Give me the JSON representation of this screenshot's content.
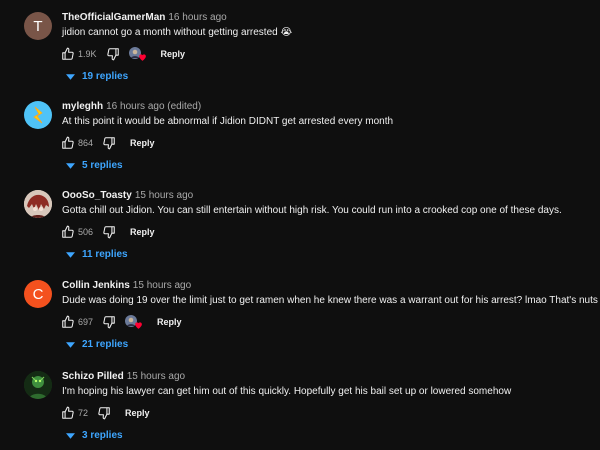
{
  "comments": [
    {
      "author": "TheOfficialGamerMan",
      "time": "16 hours ago",
      "text": "jidion cannot go a month without getting arrested 😭",
      "likes": "1.9K",
      "reply_label": "Reply",
      "replies_label": "19 replies",
      "avatar_letter": "T",
      "avatar_color": "#795548",
      "hearted": true
    },
    {
      "author": "myleghh",
      "time": "16 hours ago (edited)",
      "text": "At this point it would be abnormal if Jidion DIDNT get arrested every month",
      "likes": "864",
      "reply_label": "Reply",
      "replies_label": "5 replies",
      "avatar_icon": "yellow-lightning-icon",
      "avatar_color": "#4fc3f7",
      "hearted": false
    },
    {
      "author": "OooSo_Toasty",
      "time": "15 hours ago",
      "text": "Gotta chill out Jidion. You can still entertain without high risk. You could run into a crooked cop one of these days.",
      "likes": "506",
      "reply_label": "Reply",
      "replies_label": "11 replies",
      "avatar_icon": "anime-character-icon",
      "avatar_color": "#d8c7bb",
      "hearted": false
    },
    {
      "author": "Collin Jenkins",
      "time": "15 hours ago",
      "text": "Dude was doing 19 over the limit just to get ramen when he knew there was a warrant out for his arrest? lmao That's nuts",
      "likes": "697",
      "reply_label": "Reply",
      "replies_label": "21 replies",
      "avatar_letter": "C",
      "avatar_color": "#f4511e",
      "hearted": true
    },
    {
      "author": "Schizo Pilled",
      "time": "15 hours ago",
      "text": "I'm hoping his lawyer can get him out of this quickly. Hopefully get his bail set up or lowered somehow",
      "likes": "72",
      "reply_label": "Reply",
      "replies_label": "3 replies",
      "avatar_icon": "green-character-icon",
      "avatar_color": "#1b3d1b",
      "hearted": false
    }
  ],
  "colors": {
    "background": "#0f0f0f",
    "text": "#f1f1f1",
    "muted": "#aaaaaa",
    "link": "#3ea6ff",
    "heart": "#ff0033"
  }
}
